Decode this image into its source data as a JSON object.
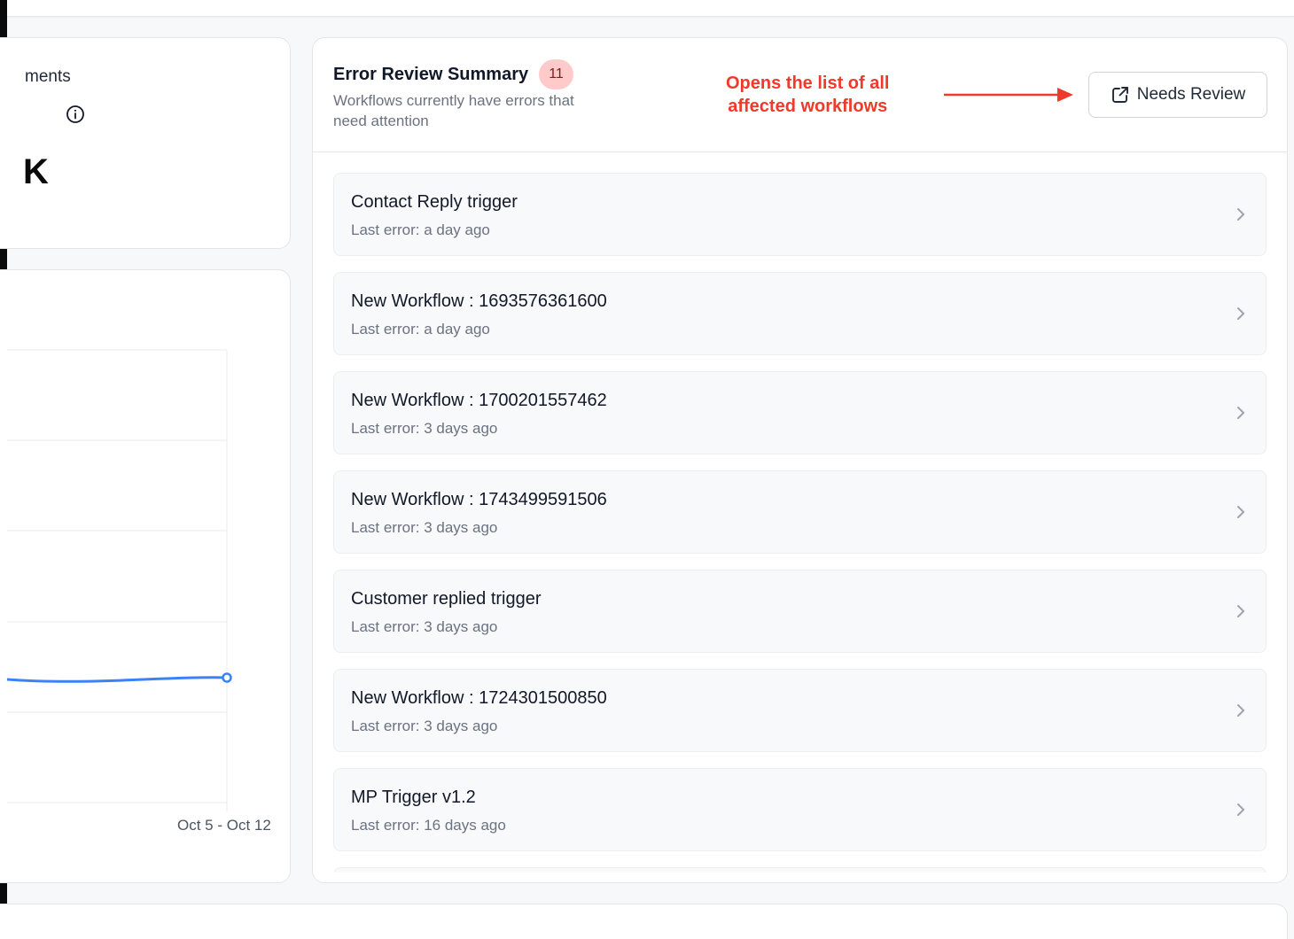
{
  "stats": {
    "label": "ments",
    "value": "K",
    "info_icon": "info-circle-icon"
  },
  "chart": {
    "x_label": "Oct 5 - Oct 12",
    "line_color": "#3b82f6"
  },
  "review": {
    "title": "Error Review Summary",
    "count": "11",
    "subtitle": "Workflows currently have errors that need attention",
    "annotation_line1": "Opens the list of all",
    "annotation_line2": "affected workflows",
    "annotation_color": "#ef3a2b",
    "button_label": "Needs Review",
    "button_icon": "external-link-icon"
  },
  "workflows": [
    {
      "name": "Contact Reply trigger",
      "last_error": "Last error: a day ago"
    },
    {
      "name": "New Workflow : 1693576361600",
      "last_error": "Last error: a day ago"
    },
    {
      "name": "New Workflow : 1700201557462",
      "last_error": "Last error: 3 days ago"
    },
    {
      "name": "New Workflow : 1743499591506",
      "last_error": "Last error: 3 days ago"
    },
    {
      "name": "Customer replied trigger",
      "last_error": "Last error: 3 days ago"
    },
    {
      "name": "New Workflow : 1724301500850",
      "last_error": "Last error: 3 days ago"
    },
    {
      "name": "MP Trigger v1.2",
      "last_error": "Last error: 16 days ago"
    },
    {
      "name": "",
      "last_error": ""
    }
  ]
}
